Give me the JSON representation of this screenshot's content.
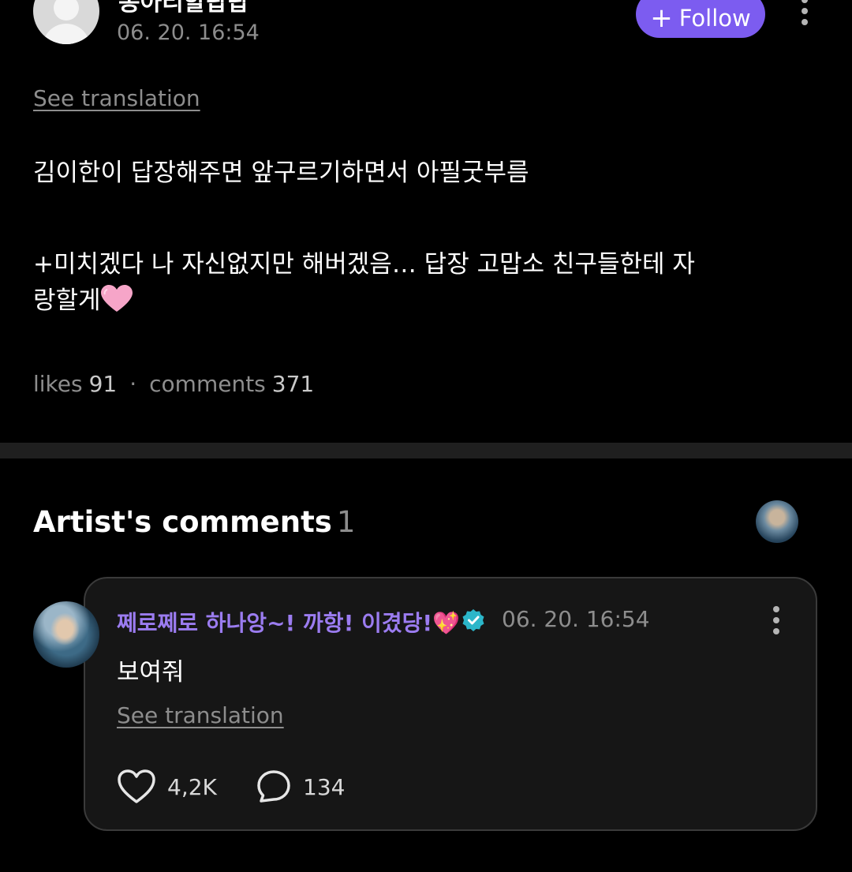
{
  "post": {
    "author": "뽕아리할랍랍",
    "timestamp": "06. 20. 16:54",
    "follow_label": "Follow",
    "see_translation": "See translation",
    "body_line1": "김이한이 답장해주면 앞구르기하면서  아필굿부름",
    "body_line2": "+미치겠다 나 자신없지만 해버겠음… 답장 고맙소 친구들한테 자",
    "body_line3": "랑할게",
    "likes_label": "likes",
    "likes_count": "91",
    "comments_label": "comments",
    "comments_count": "371"
  },
  "artist_section": {
    "title": "Artist's comments",
    "count": "1"
  },
  "comment": {
    "author": "쩨로쩨로 하나앙~! 까항! 이겼당!💖",
    "timestamp": "06. 20. 16:54",
    "text": "보여줘",
    "see_translation": "See translation",
    "likes": "4,2K",
    "replies": "134"
  },
  "colors": {
    "accent": "#7c5cf0",
    "author_name": "#9b7cf0",
    "verified": "#2bb6c9",
    "background": "#000000",
    "muted": "#8d8d8d"
  },
  "icons": [
    "user-icon",
    "plus-icon",
    "more-icon",
    "heart-emoji",
    "verified-icon",
    "heart-icon",
    "comment-icon"
  ]
}
